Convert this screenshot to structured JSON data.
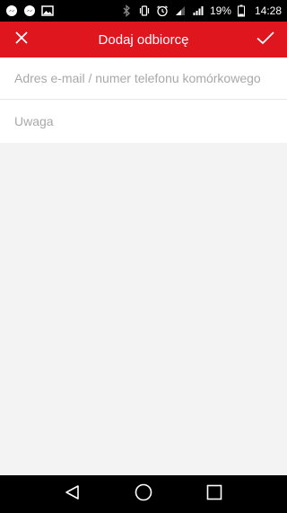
{
  "status_bar": {
    "battery_percent": "19%",
    "time": "14:28",
    "left_icons": [
      "messenger-icon",
      "messenger-icon",
      "image-icon"
    ],
    "right_icons": [
      "bluetooth-icon",
      "vibrate-icon",
      "alarm-icon",
      "wifi-icon",
      "signal-icon",
      "battery-icon"
    ]
  },
  "app_bar": {
    "title": "Dodaj odbiorcę",
    "close_icon": "close-icon",
    "confirm_icon": "check-icon",
    "color": "#e0161f"
  },
  "form": {
    "recipient_placeholder": "Adres e-mail / numer telefonu komórkowego",
    "recipient_value": "",
    "note_placeholder": "Uwaga",
    "note_value": ""
  },
  "nav_bar": {
    "back_icon": "back-icon",
    "home_icon": "home-icon",
    "recents_icon": "recents-icon"
  }
}
